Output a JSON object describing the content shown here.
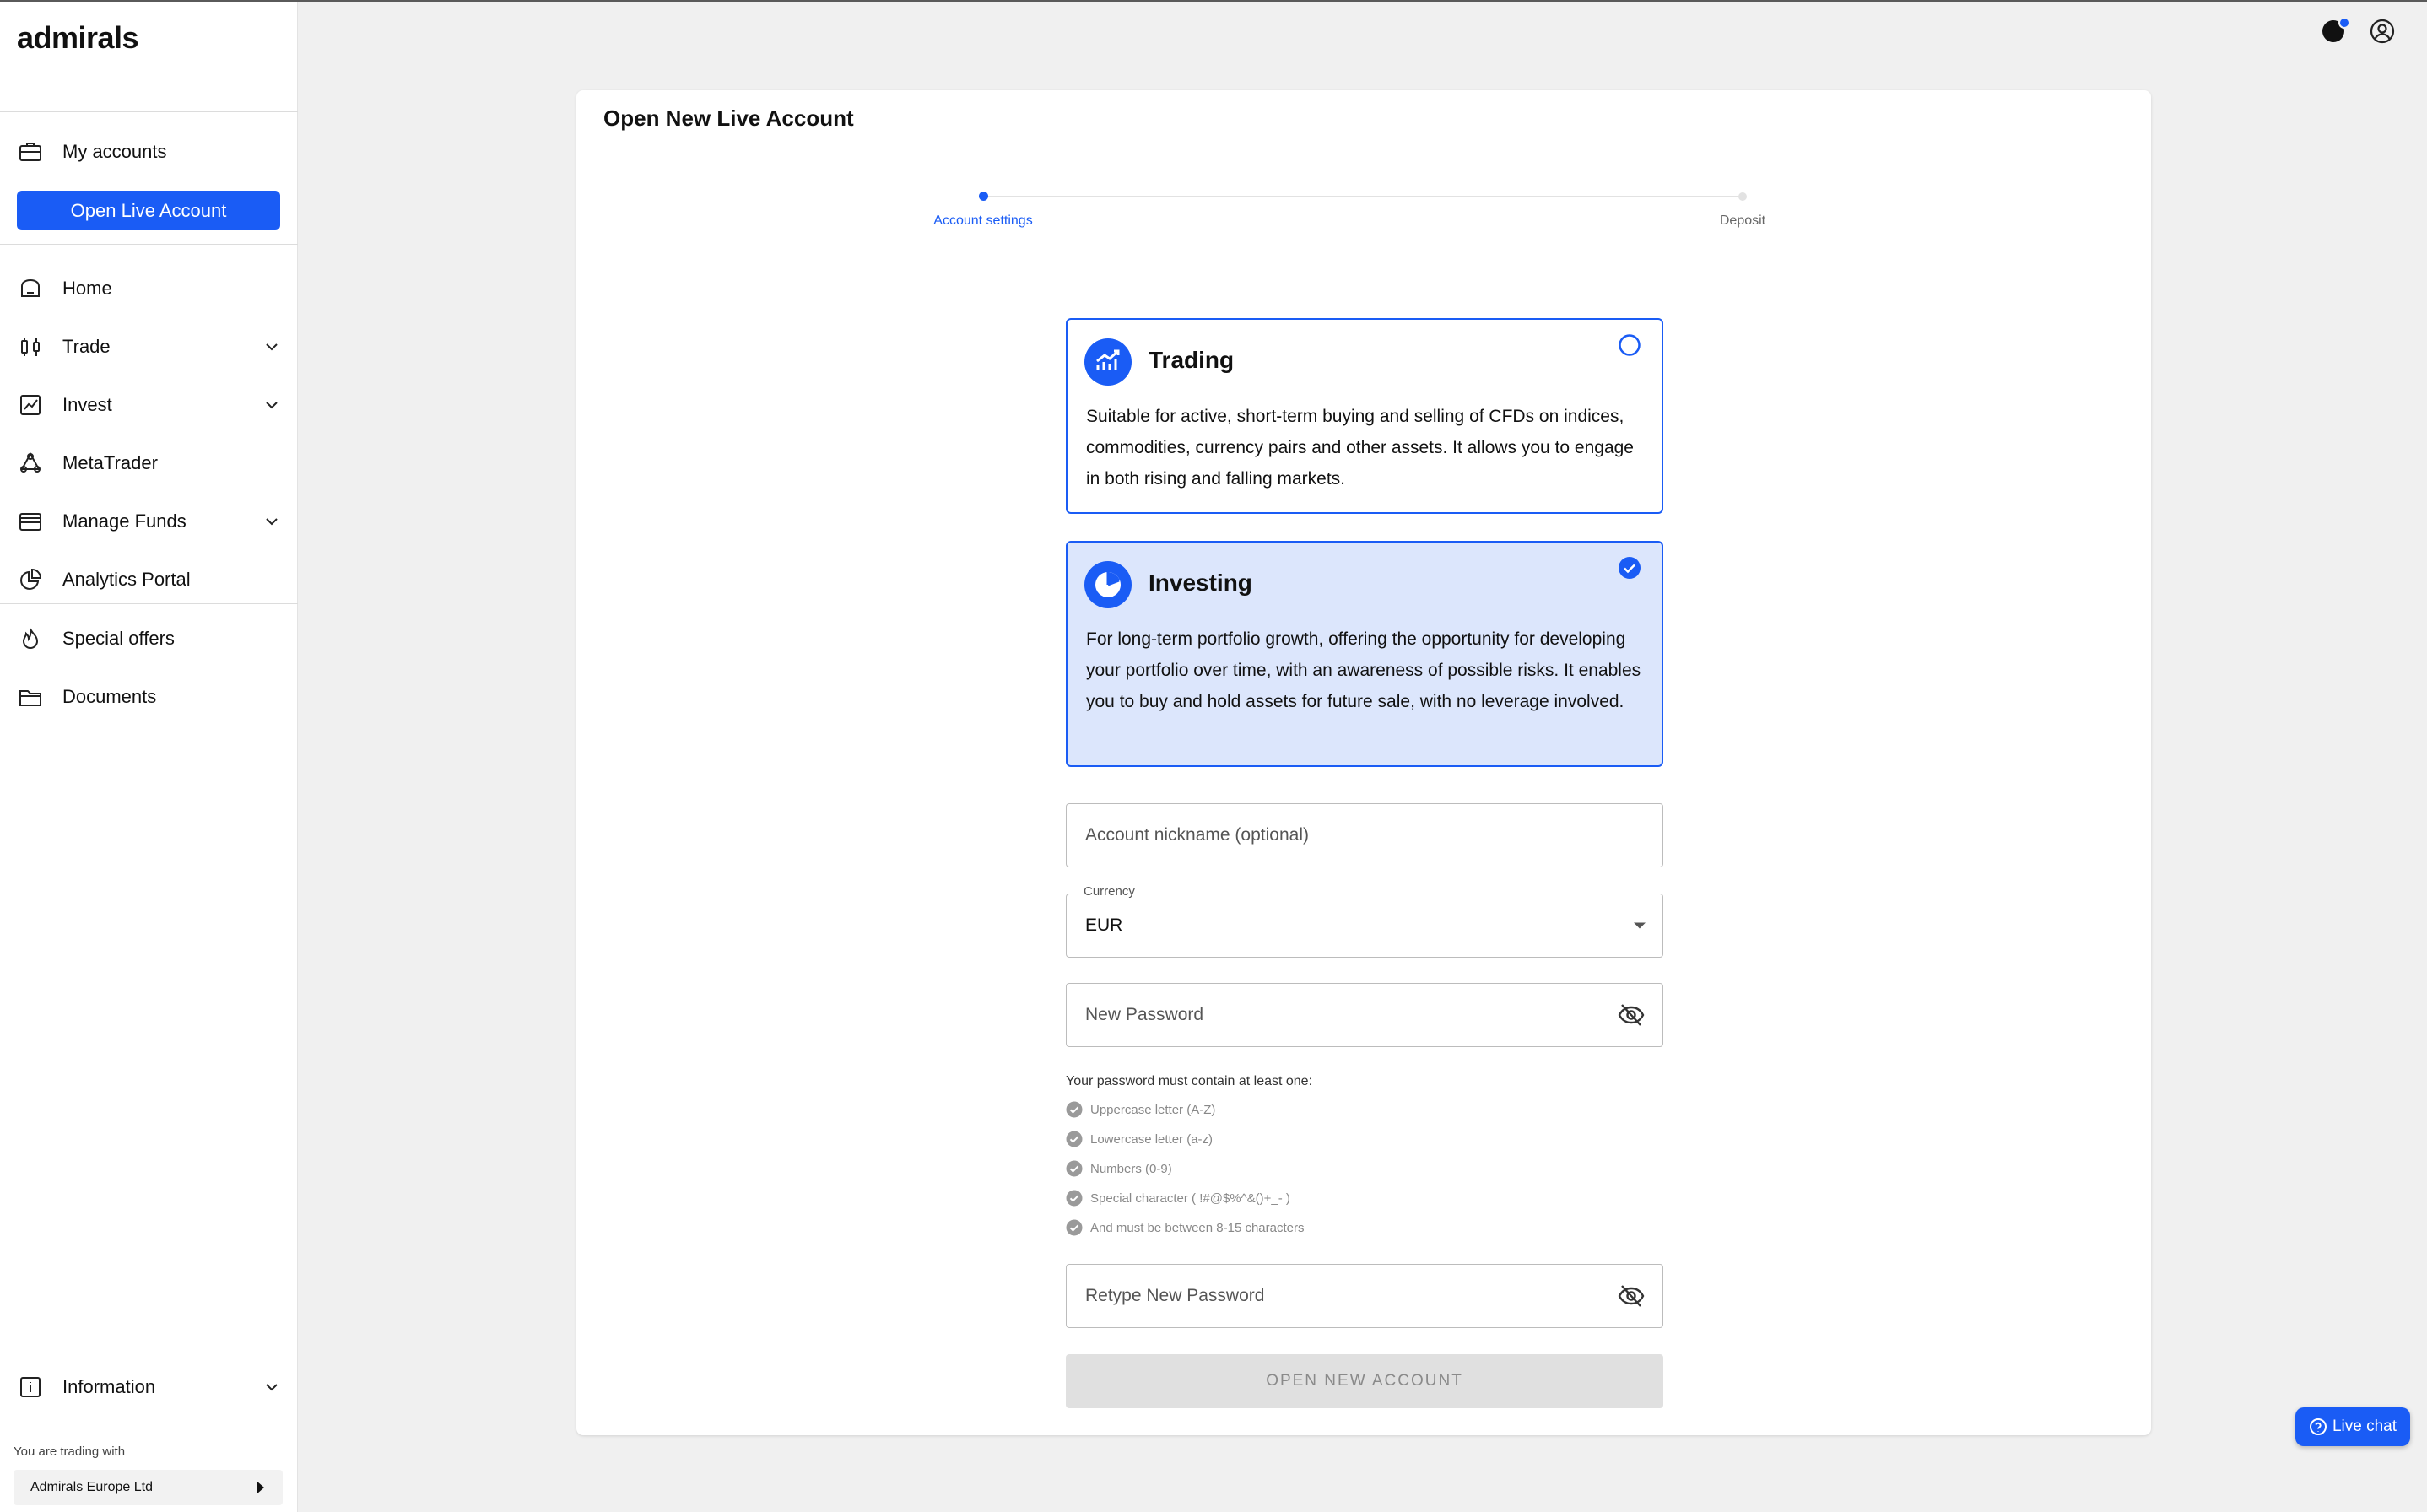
{
  "brand": {
    "logo_text": "admirals"
  },
  "sidebar": {
    "my_accounts": "My accounts",
    "open_live_account": "Open Live Account",
    "items": [
      {
        "label": "Home",
        "icon": "home-icon"
      },
      {
        "label": "Trade",
        "icon": "candlestick-icon",
        "expandable": true
      },
      {
        "label": "Invest",
        "icon": "chart-line-icon",
        "expandable": true
      },
      {
        "label": "MetaTrader",
        "icon": "metatrader-icon"
      },
      {
        "label": "Manage Funds",
        "icon": "wallet-icon",
        "expandable": true
      },
      {
        "label": "Analytics Portal",
        "icon": "pie-chart-icon"
      },
      {
        "label": "Special offers",
        "icon": "flame-icon"
      },
      {
        "label": "Documents",
        "icon": "folder-icon"
      }
    ],
    "information": "Information",
    "trading_with_label": "You are trading with",
    "entity": "Admirals Europe Ltd"
  },
  "page": {
    "title": "Open New Live Account",
    "steps": [
      "Account settings",
      "Deposit"
    ],
    "active_step": 0
  },
  "options": {
    "trading": {
      "title": "Trading",
      "description": "Suitable for active, short-term buying and selling of CFDs on indices, commodities, currency pairs and other assets. It allows you to engage in both rising and falling markets.",
      "selected": false
    },
    "investing": {
      "title": "Investing",
      "description": "For long-term portfolio growth, offering the opportunity for developing your portfolio over time, with an awareness of possible risks. It enables you to buy and hold assets for future sale, with no leverage involved.",
      "selected": true
    }
  },
  "form": {
    "nickname_placeholder": "Account nickname (optional)",
    "currency_label": "Currency",
    "currency_value": "EUR",
    "password_placeholder": "New Password",
    "retype_placeholder": "Retype New Password",
    "requirements_title": "Your password must contain at least one:",
    "requirements": [
      "Uppercase letter (A-Z)",
      "Lowercase letter (a-z)",
      "Numbers (0-9)",
      "Special character ( !#@$%^&()+_- )",
      "And must be between 8-15 characters"
    ],
    "submit_label": "OPEN NEW ACCOUNT"
  },
  "livechat": {
    "label": "Live chat"
  },
  "colors": {
    "accent": "#1a5cf5",
    "selected_bg": "#dce6fc"
  }
}
